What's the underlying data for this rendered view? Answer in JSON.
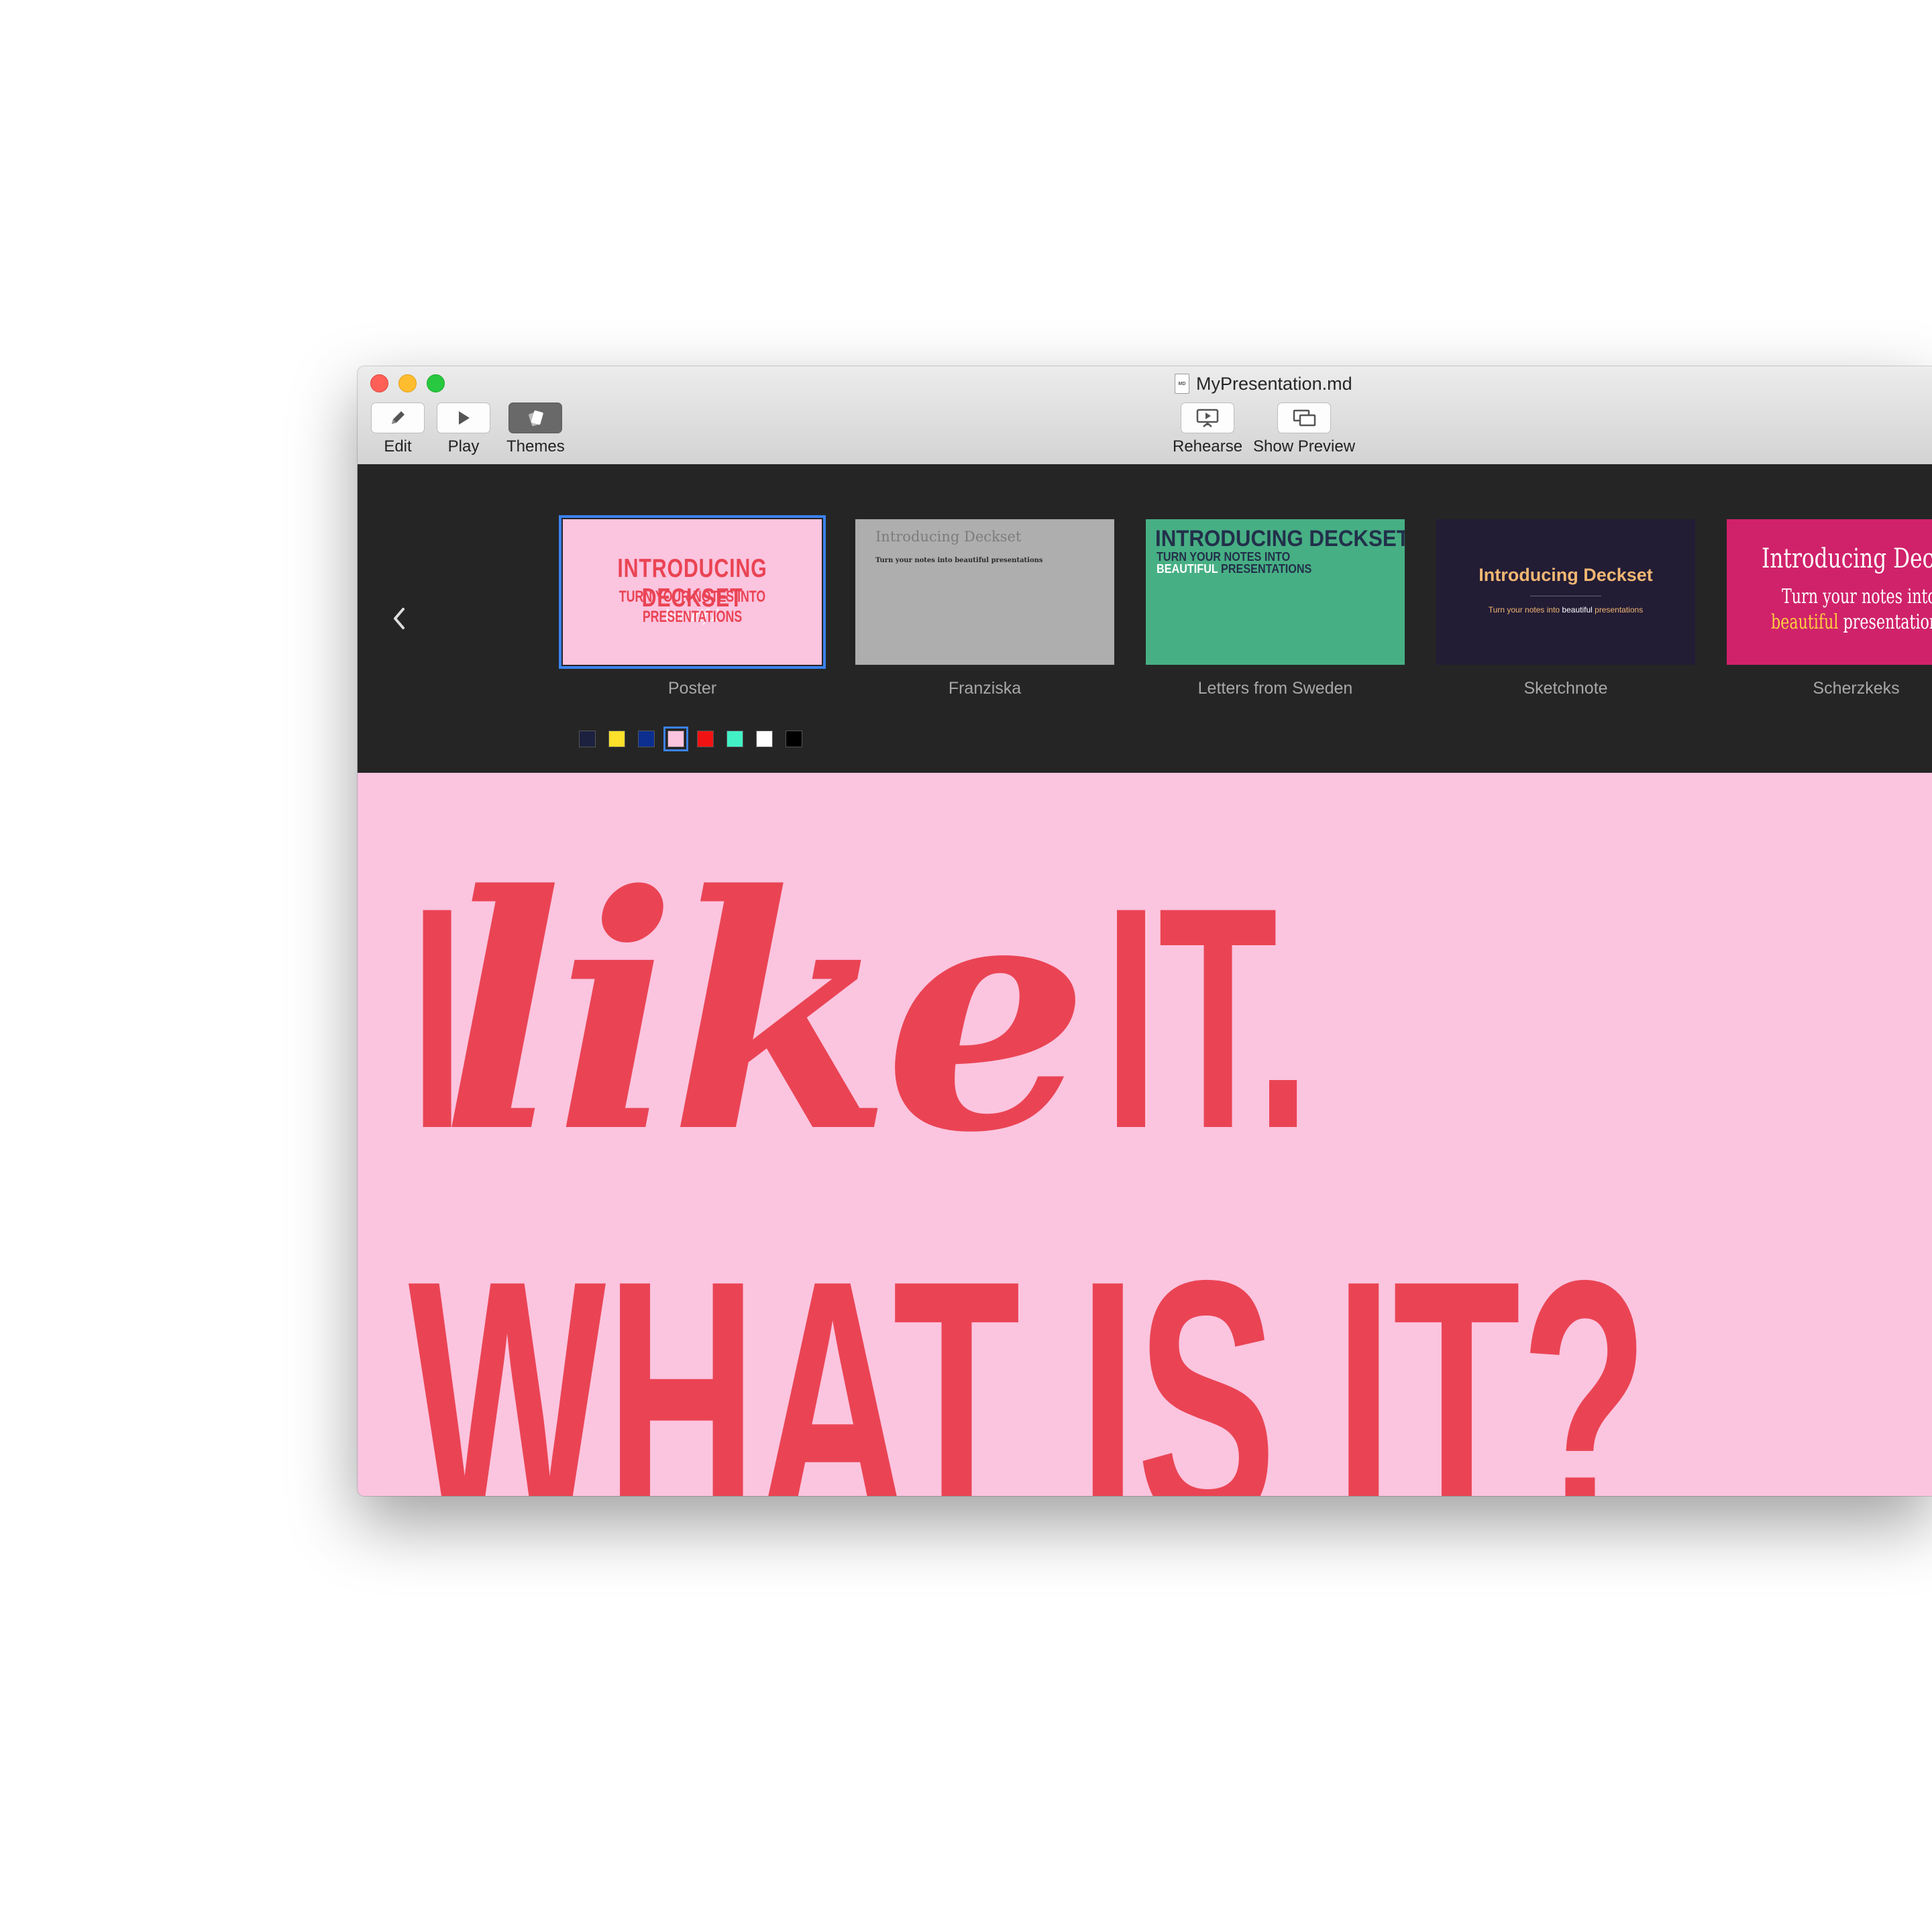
{
  "window": {
    "title": "MyPresentation.md",
    "doc_icon_text": "MD"
  },
  "toolbar": {
    "edit_label": "Edit",
    "play_label": "Play",
    "themes_label": "Themes",
    "rehearse_label": "Rehearse",
    "show_preview_label": "Show Preview"
  },
  "themes": [
    {
      "name": "Poster",
      "selected": true,
      "title": "INTRODUCING DECKSET",
      "sub1": "TURN YOUR NOTES INTO",
      "sub_em": "beautiful",
      "sub2": "PRESENTATIONS"
    },
    {
      "name": "Franziska",
      "title": "Introducing Deckset",
      "sub": "Turn your notes into beautiful presentations"
    },
    {
      "name": "Letters from Sweden",
      "title": "INTRODUCING DECKSET",
      "sub1": "TURN YOUR NOTES INTO",
      "sub_em": "BEAUTIFUL",
      "sub2": "PRESENTATIONS"
    },
    {
      "name": "Sketchnote",
      "title": "Introducing Deckset",
      "sub1": "Turn your notes into",
      "sub_em": "beautiful",
      "sub2": "presentations"
    },
    {
      "name": "Scherzkeks",
      "title": "Introducing Decks",
      "sub1": "Turn your notes into",
      "sub_em": "beautiful",
      "sub2": "presentation"
    }
  ],
  "swatches": [
    "#1c2140",
    "#fde02a",
    "#0c2f8f",
    "#fbc4df",
    "#f11313",
    "#42f1c6",
    "#ffffff",
    "#000000"
  ],
  "selected_swatch": 3,
  "pager": {
    "pages": 3,
    "current": 3
  },
  "slide": {
    "line1_a": "I",
    "line1_script": "like",
    "line1_b": "IT.",
    "line2": "WHAT IS IT?"
  },
  "colors": {
    "accent": "#ea4454",
    "slide_bg": "#fbc4df",
    "selection": "#3b82f0"
  }
}
